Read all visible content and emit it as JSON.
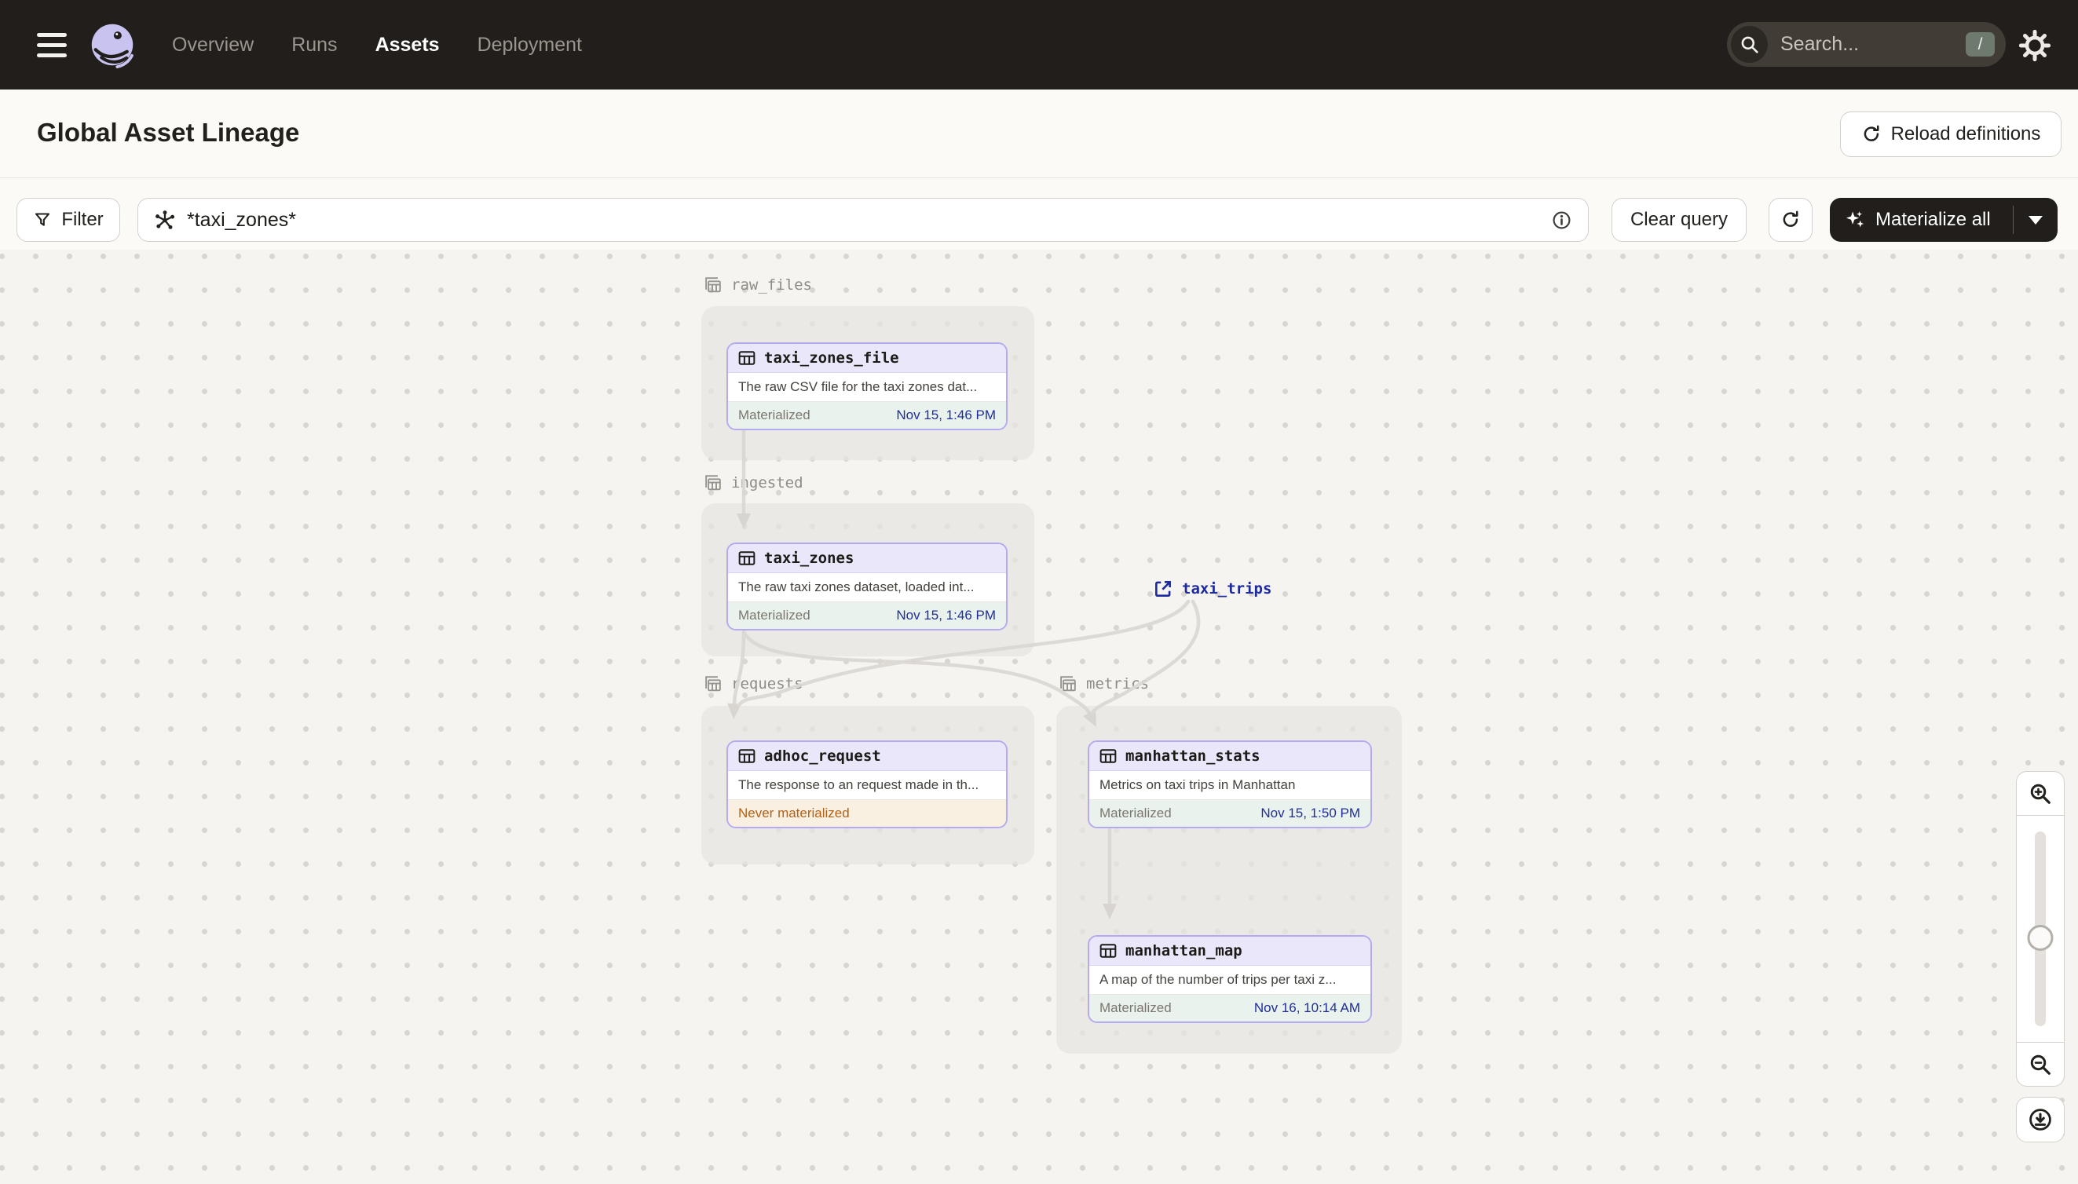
{
  "nav": {
    "items": [
      {
        "label": "Overview",
        "active": false
      },
      {
        "label": "Runs",
        "active": false
      },
      {
        "label": "Assets",
        "active": true
      },
      {
        "label": "Deployment",
        "active": false
      }
    ]
  },
  "search": {
    "placeholder": "Search...",
    "shortcut": "/"
  },
  "header": {
    "title": "Global Asset Lineage",
    "reload_label": "Reload definitions"
  },
  "toolbar": {
    "filter_label": "Filter",
    "query_value": "*taxi_zones*",
    "clear_label": "Clear query",
    "materialize_label": "Materialize all"
  },
  "graph": {
    "groups": [
      {
        "name": "raw_files"
      },
      {
        "name": "ingested"
      },
      {
        "name": "requests"
      },
      {
        "name": "metrics"
      }
    ],
    "nodes": [
      {
        "title": "taxi_zones_file",
        "description": "The raw CSV file for the taxi zones dat...",
        "status": "Materialized",
        "timestamp": "Nov 15, 1:46 PM",
        "group": "raw_files"
      },
      {
        "title": "taxi_zones",
        "description": "The raw taxi zones dataset, loaded int...",
        "status": "Materialized",
        "timestamp": "Nov 15, 1:46 PM",
        "group": "ingested"
      },
      {
        "title": "adhoc_request",
        "description": "The response to an request made in th...",
        "status": "Never materialized",
        "timestamp": "",
        "group": "requests"
      },
      {
        "title": "manhattan_stats",
        "description": "Metrics on taxi trips in Manhattan",
        "status": "Materialized",
        "timestamp": "Nov 15, 1:50 PM",
        "group": "metrics"
      },
      {
        "title": "manhattan_map",
        "description": "A map of the number of trips per taxi z...",
        "status": "Materialized",
        "timestamp": "Nov 16, 10:14 AM",
        "group": "metrics"
      }
    ],
    "external_nodes": [
      {
        "title": "taxi_trips"
      }
    ]
  },
  "icons": {
    "hamburger": "menu-icon",
    "logo": "dagster-logo",
    "search": "magnifier-icon",
    "settings": "gear-icon",
    "reload": "refresh-icon",
    "filter": "funnel-icon",
    "query": "asset-graph-icon",
    "info": "info-icon",
    "materialize": "sparkle-icon",
    "asset": "table-icon",
    "group": "layered-table-icon",
    "external": "external-link-icon",
    "zoom_in": "zoom-in-icon",
    "zoom_out": "zoom-out-icon",
    "download": "download-icon"
  },
  "colors": {
    "topbar_bg": "#221e1b",
    "page_bg": "#fbfaf7",
    "canvas_bg": "#f5f4f0",
    "node_border": "#b3aaef",
    "node_header_bg": "#eae7fa",
    "materialized_bg": "#e9f2ec",
    "never_materialized_bg": "#faf0e1",
    "never_materialized_text": "#b06118",
    "timestamp_link": "#202e9a",
    "edge": "#dbd8d3",
    "logo_lavender": "#c9c3f0"
  }
}
